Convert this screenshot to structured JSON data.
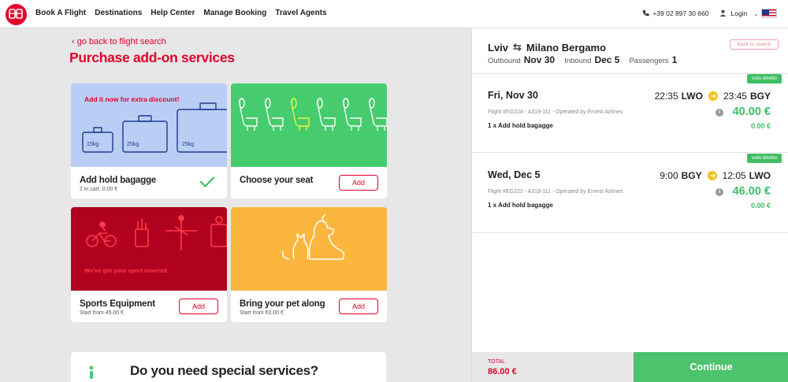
{
  "header": {
    "nav": [
      "Book A Flight",
      "Destinations",
      "Help Center",
      "Manage Booking",
      "Travel Agents"
    ],
    "phone": "+39 02 897 30 660",
    "login": "Login",
    "language_icon": "us-flag-icon"
  },
  "page": {
    "back_link": "go back to flight search",
    "title": "Purchase add-on services"
  },
  "addons": [
    {
      "name": "Add hold bagagge",
      "sub": "2 in cart, 0.00 €",
      "promo": "Add it now for extra discount!",
      "bag_labels": [
        "15kg",
        "20kg",
        "25kg"
      ],
      "status": "added",
      "color": "#b9cdf5"
    },
    {
      "name": "Choose your seat",
      "button": "Add",
      "color": "#46cc6e"
    },
    {
      "name": "Sports Equipment",
      "sub": "Start from 45.00 €",
      "promo": "We've got your sport covered.",
      "button": "Add",
      "color": "#b0021f"
    },
    {
      "name": "Bring your pet along",
      "sub": "Start from €0.00 €",
      "button": "Add",
      "color": "#fbb63e"
    }
  ],
  "special": {
    "question": "Do you need special services?"
  },
  "summary": {
    "from": "Lviv",
    "to": "Milano Bergamo",
    "back_button": "Back to search",
    "outbound_label": "Outbound",
    "outbound_date": "Nov 30",
    "inbound_label": "Inbound",
    "inbound_date": "Dec 5",
    "passengers_label": "Passengers",
    "passengers": "1",
    "segments": [
      {
        "badge": "volo diretto",
        "date": "Fri, Nov 30",
        "dep_time": "22:35",
        "dep_code": "LWO",
        "arr_time": "23:45",
        "arr_code": "BGY",
        "flight": "Flight #EG224 - A319-111 - Operated by Ernest Airlines",
        "price": "40.00 €",
        "item": "1 x Add hold bagagge",
        "item_price": "0.00 €"
      },
      {
        "badge": "volo diretto",
        "date": "Wed, Dec 5",
        "dep_time": "9:00",
        "dep_code": "BGY",
        "arr_time": "12:05",
        "arr_code": "LWO",
        "flight": "Flight #EG223 - A319-111 - Operated by Ernest Airlines",
        "price": "46.00 €",
        "item": "1 x Add hold bagagge",
        "item_price": "0.00 €"
      }
    ],
    "total_label": "TOTAL",
    "total_value": "86.00 €",
    "continue_label": "Continue"
  }
}
